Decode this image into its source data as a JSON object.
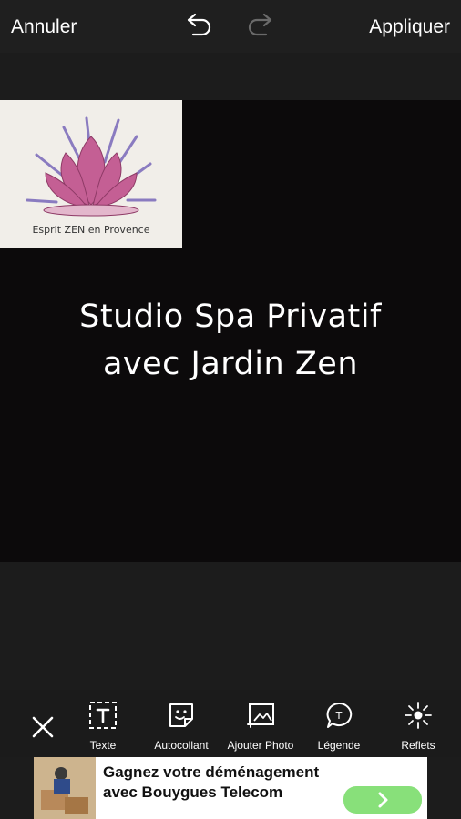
{
  "topbar": {
    "cancel_label": "Annuler",
    "apply_label": "Appliquer",
    "undo_icon": "undo-icon",
    "redo_icon": "redo-icon"
  },
  "canvas": {
    "logo_caption": "Esprit ZEN en Provence",
    "title_line1": "Studio Spa Privatif",
    "title_line2": "avec Jardin Zen"
  },
  "toolbar": {
    "close_icon": "close-icon",
    "tools": [
      {
        "label": "Texte",
        "icon": "text-icon"
      },
      {
        "label": "Autocollant",
        "icon": "sticker-icon"
      },
      {
        "label": "Ajouter Photo",
        "icon": "add-photo-icon"
      },
      {
        "label": "Légende",
        "icon": "caption-bubble-icon"
      },
      {
        "label": "Reflets",
        "icon": "lens-flare-icon"
      }
    ]
  },
  "ad": {
    "headline": "Gagnez votre déménagement avec Bouygues Telecom",
    "cta_icon": "chevron-right-icon",
    "accent_color": "#88e07a"
  }
}
